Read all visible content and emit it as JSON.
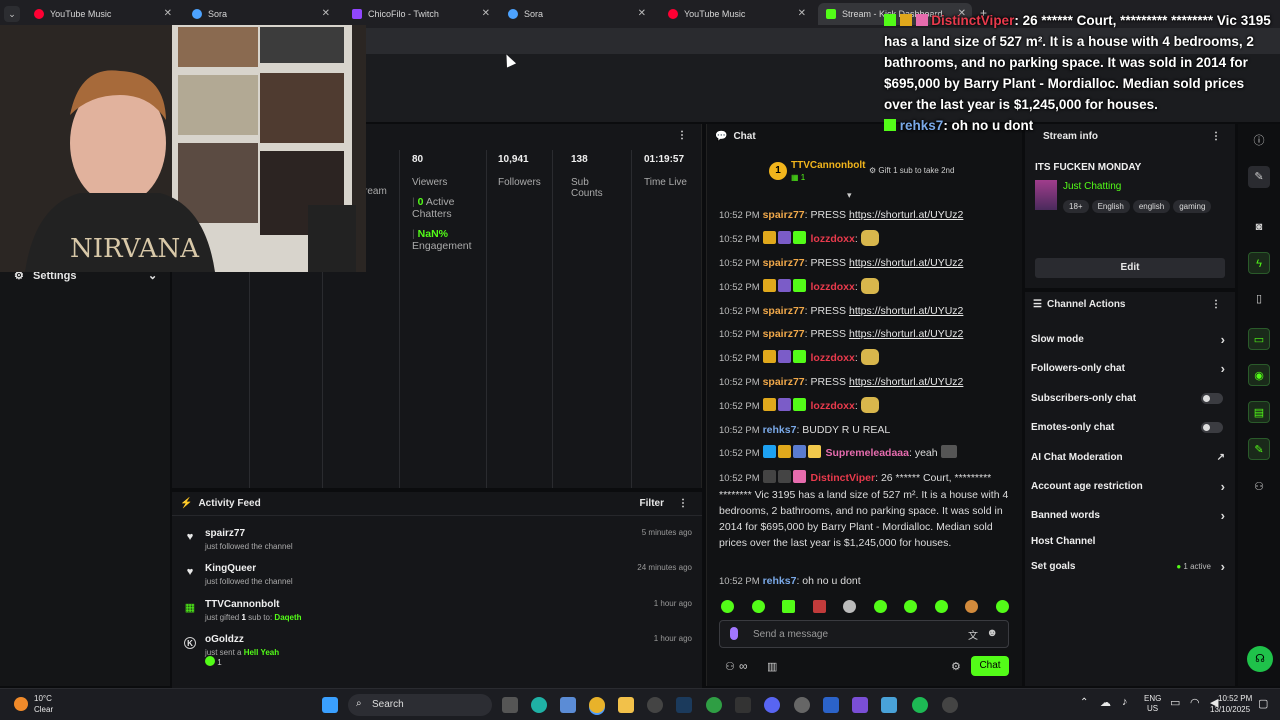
{
  "tabs": [
    {
      "label": "YouTube Music",
      "fav": "#ff0033"
    },
    {
      "label": "Sora",
      "fav": "#4da3ff"
    },
    {
      "label": "ChicoFilo - Twitch",
      "fav": "#9146ff"
    },
    {
      "label": "Sora",
      "fav": "#4da3ff"
    },
    {
      "label": "YouTube Music",
      "fav": "#ff0033"
    },
    {
      "label": "Stream - Kick Dashboard",
      "fav": "#53fc18"
    }
  ],
  "sidebar": {
    "settings": "Settings"
  },
  "stats": {
    "stream_label": "ream",
    "viewers": "80",
    "viewers_label": "Viewers",
    "active": "0",
    "active_label": "Active",
    "chatters_label": "Chatters",
    "engagement": "NaN%",
    "engagement_label": "Engagement",
    "followers": "10,941",
    "followers_label": "Followers",
    "subs": "138",
    "subs_label": "Sub",
    "subs_label2": "Counts",
    "time": "01:19:57",
    "time_label": "Time Live"
  },
  "activity": {
    "title": "Activity Feed",
    "filter": "Filter",
    "items": [
      {
        "name": "spairz77",
        "desc": "just followed the channel",
        "time": "5 minutes ago"
      },
      {
        "name": "KingQueer",
        "desc": "just followed the channel",
        "time": "24 minutes ago"
      },
      {
        "name": "TTVCannonbolt",
        "desc": "just gifted",
        "count": "1",
        "desc2": "sub to:",
        "target": "Daqeth",
        "time": "1 hour ago"
      },
      {
        "name": "oGoldzz",
        "desc": "just sent a",
        "gift": "Hell Yeah",
        "qty": "1",
        "time": "1 hour ago"
      }
    ]
  },
  "chat": {
    "title": "Chat",
    "top_gifter": "TTVCannonbolt",
    "top_rank": "1",
    "top_count": "1",
    "gift_hint": "Gift 1 sub to take 2nd",
    "messages": [
      {
        "time": "10:52 PM",
        "user": "spairz77",
        "text": "PRESS",
        "link": "https://shorturl.at/UYUz2"
      },
      {
        "time": "10:52 PM",
        "user": "lozzdoxx",
        "text": ""
      },
      {
        "time": "10:52 PM",
        "user": "spairz77",
        "text": "PRESS",
        "link": "https://shorturl.at/UYUz2"
      },
      {
        "time": "10:52 PM",
        "user": "lozzdoxx",
        "text": ""
      },
      {
        "time": "10:52 PM",
        "user": "spairz77",
        "text": "PRESS",
        "link": "https://shorturl.at/UYUz2"
      },
      {
        "time": "10:52 PM",
        "user": "spairz77",
        "text": "PRESS",
        "link": "https://shorturl.at/UYUz2"
      },
      {
        "time": "10:52 PM",
        "user": "lozzdoxx",
        "text": ""
      },
      {
        "time": "10:52 PM",
        "user": "spairz77",
        "text": "PRESS",
        "link": "https://shorturl.at/UYUz2"
      },
      {
        "time": "10:52 PM",
        "user": "lozzdoxx",
        "text": ""
      },
      {
        "time": "10:52 PM",
        "user": "rehks7",
        "text": "BUDDY R U REAL"
      },
      {
        "time": "10:52 PM",
        "user": "Supremeleadaaa",
        "text": "yeah"
      },
      {
        "time": "10:52 PM",
        "user": "DistinctViper",
        "text": "26 ****** Court, ********* ******** Vic 3195 has a land size of 527 m². It is a house with 4 bedrooms, 2 bathrooms, and no parking space. It was sold in 2014 for $695,000 by Barry Plant - Mordialloc. Median sold prices over the last year is $1,245,000 for houses."
      },
      {
        "time": "10:52 PM",
        "user": "rehks7",
        "text": "oh no u dont"
      }
    ],
    "placeholder": "Send a message",
    "send": "Chat"
  },
  "info": {
    "title": "Stream info",
    "stream_title": "ITS FUCKEN MONDAY",
    "category": "Just Chatting",
    "tags": [
      "18+",
      "English",
      "english",
      "gaming"
    ],
    "edit": "Edit"
  },
  "actions": {
    "title": "Channel Actions",
    "slow": "Slow mode",
    "followers": "Followers-only chat",
    "subs": "Subscribers-only chat",
    "emotes": "Emotes-only chat",
    "ai": "AI Chat Moderation",
    "age": "Account age restriction",
    "banned": "Banned words",
    "host": "Host Channel",
    "goals": "Set goals",
    "goals_active": "1 active"
  },
  "overlay": {
    "user1": "DistinctViper",
    "text1": ": 26 ****** Court, ********* ******** Vic 3195 has a land size of 527 m². It is a house with 4 bedrooms, 2 bathrooms, and no parking space. It was sold in 2014 for $695,000 by Barry Plant - Mordialloc. Median sold prices over the last year is $1,245,000 for houses.",
    "user2": "rehks7",
    "text2": ": oh no u dont"
  },
  "taskbar": {
    "temp": "10°C",
    "weather": "Clear",
    "search": "Search",
    "lang1": "ENG",
    "lang2": "US",
    "time": "10:52 PM",
    "date": "13/10/2025"
  },
  "colors": {
    "kick_green": "#53fc18",
    "bg": "#0b0c0e",
    "panel": "#151619"
  }
}
